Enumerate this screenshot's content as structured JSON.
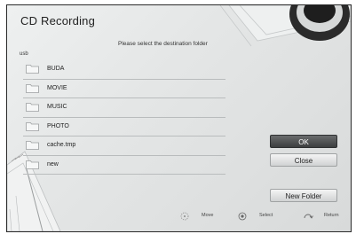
{
  "window": {
    "title": "CD Recording"
  },
  "dialog": {
    "prompt": "Please select the destination folder",
    "path": "usb"
  },
  "folders": [
    {
      "name": "BUDA"
    },
    {
      "name": "MOVIE"
    },
    {
      "name": "MUSIC"
    },
    {
      "name": "PHOTO"
    },
    {
      "name": "cache.tmp"
    },
    {
      "name": "new"
    }
  ],
  "buttons": {
    "ok": "OK",
    "close": "Close",
    "new_folder": "New Folder"
  },
  "footer": {
    "move": "Move",
    "select": "Select",
    "return": "Return"
  },
  "colors": {
    "selected_button": "#4a4c4d",
    "background": "#e4e6e6",
    "divider": "#b9bcbd"
  }
}
